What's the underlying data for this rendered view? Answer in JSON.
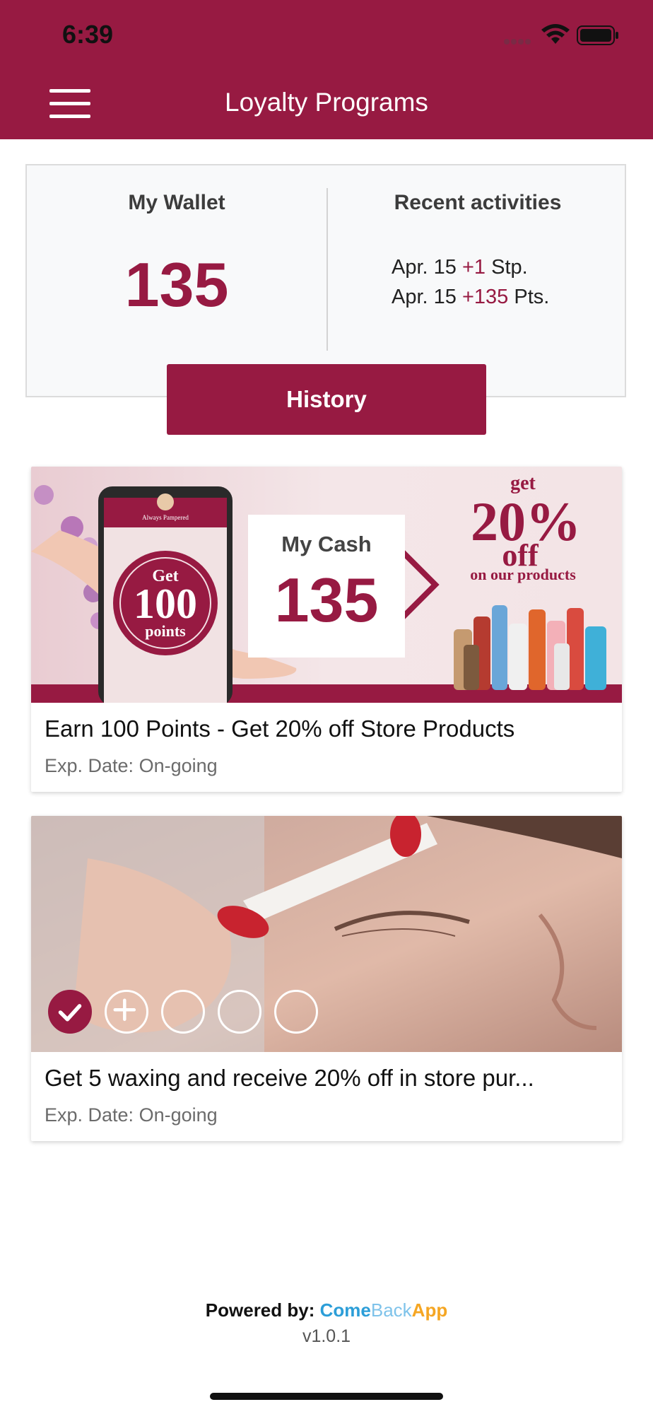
{
  "status_bar": {
    "time": "6:39"
  },
  "header": {
    "title": "Loyalty Programs",
    "menu_icon": "hamburger-menu-icon"
  },
  "wallet": {
    "label": "My Wallet",
    "value": "135",
    "recent_label": "Recent activities",
    "activities": [
      {
        "date": "Apr. 15",
        "amount": "+1",
        "unit": "Stp."
      },
      {
        "date": "Apr. 15",
        "amount": "+135",
        "unit": "Pts."
      }
    ],
    "history_button": "History"
  },
  "cards": [
    {
      "title": "Earn 100 Points - Get 20% off Store Products",
      "exp": "Exp. Date: On-going",
      "banner": {
        "brand": "Always Pampered",
        "badge_get": "Get",
        "badge_number": "100",
        "badge_points": "points",
        "cash_label": "My Cash",
        "cash_value": "135",
        "offer_get": "get",
        "offer_percent": "20%",
        "offer_off": "off",
        "offer_sub": "on our products"
      }
    },
    {
      "title": "Get 5 waxing and receive 20% off in store pur...",
      "exp": "Exp. Date: On-going",
      "stamps": {
        "total": 5,
        "filled": 1
      }
    }
  ],
  "footer": {
    "powered_label": "Powered by:",
    "brand_come": "Come",
    "brand_back": "Back",
    "brand_app": "App",
    "version": "v1.0.1"
  },
  "colors": {
    "brand": "#971a42",
    "background": "#ffffff"
  }
}
